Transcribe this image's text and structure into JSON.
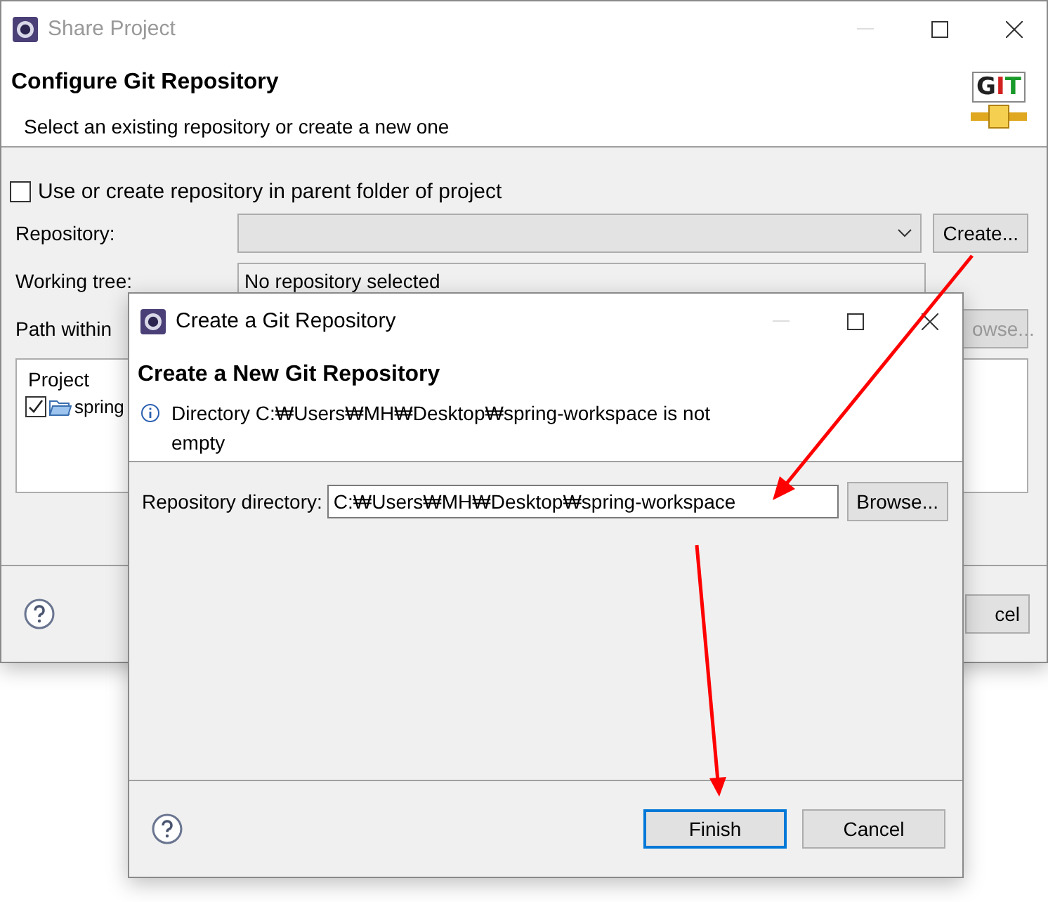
{
  "outer_window": {
    "title": "Share Project",
    "header": {
      "title": "Configure Git Repository",
      "description": "Select an existing repository or create a new one",
      "logo": "GIT"
    },
    "parent_folder_checkbox": {
      "label": "Use or create repository in parent folder of project",
      "checked": false
    },
    "repository": {
      "label": "Repository:"
    },
    "create_button": "Create...",
    "working_tree": {
      "label": "Working tree:",
      "value": "No repository selected"
    },
    "path_within": {
      "label": "Path within"
    },
    "browse_button": "owse...",
    "projects": {
      "column": "Project",
      "rows": [
        {
          "name": "spring",
          "checked": true
        }
      ]
    },
    "cancel_button": "cel"
  },
  "inner_window": {
    "title": "Create a Git Repository",
    "header": {
      "title": "Create a New Git Repository",
      "message": "Directory C:₩Users₩MH₩Desktop₩spring-workspace is not empty"
    },
    "repository_directory": {
      "label": "Repository directory:",
      "value": "C:₩Users₩MH₩Desktop₩spring-workspace"
    },
    "browse_button": "Browse...",
    "buttons": [
      {
        "label": "Finish",
        "default": true
      },
      {
        "label": "Cancel",
        "default": false
      }
    ]
  }
}
